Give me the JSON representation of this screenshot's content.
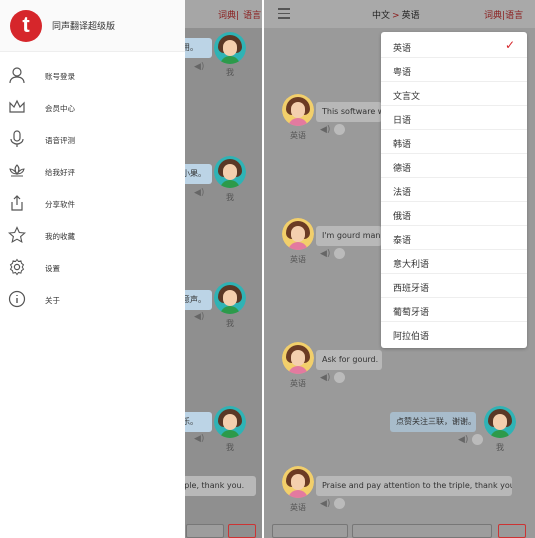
{
  "left": {
    "topbar_links": [
      "词典",
      "语言"
    ],
    "drawer": {
      "logo_letter": "t",
      "app_name": "同声翻译超级版",
      "items": [
        {
          "label": "账号登录",
          "icon": "user-icon"
        },
        {
          "label": "会员中心",
          "icon": "crown-icon"
        },
        {
          "label": "语音评测",
          "icon": "microphone-icon"
        },
        {
          "label": "给我好评",
          "icon": "lotus-icon"
        },
        {
          "label": "分享软件",
          "icon": "share-icon"
        },
        {
          "label": "我的收藏",
          "icon": "star-icon"
        },
        {
          "label": "设置",
          "icon": "gear-icon"
        },
        {
          "label": "关于",
          "icon": "info-icon"
        }
      ]
    },
    "bubbles": [
      {
        "text": "用。"
      },
      {
        "text": "小果。"
      },
      {
        "text": "意声。"
      },
      {
        "text": "乐。"
      },
      {
        "text": "iple, thank you."
      }
    ],
    "avatar_label": "我"
  },
  "right": {
    "title_source": "中文",
    "title_arrow": ">",
    "title_target": "英语",
    "topbar_links": [
      "词典",
      "语言"
    ],
    "languages": [
      "英语",
      "粤语",
      "文言文",
      "日语",
      "韩语",
      "德语",
      "法语",
      "俄语",
      "泰语",
      "意大利语",
      "西班牙语",
      "葡萄牙语",
      "阿拉伯语"
    ],
    "selected_language": "英语",
    "check_mark": "✓",
    "avatar_label_english": "英语",
    "avatar_label_me": "我",
    "bubbles": [
      {
        "text": "This software w"
      },
      {
        "text": "I'm gourd man"
      },
      {
        "text": "Ask for gourd."
      },
      {
        "text": "点赞关注三联，谢谢。"
      },
      {
        "text": "Praise and pay attention to the triple, thank you."
      }
    ]
  },
  "colors": {
    "accent": "#d6262b",
    "link": "#8a1c1c"
  }
}
